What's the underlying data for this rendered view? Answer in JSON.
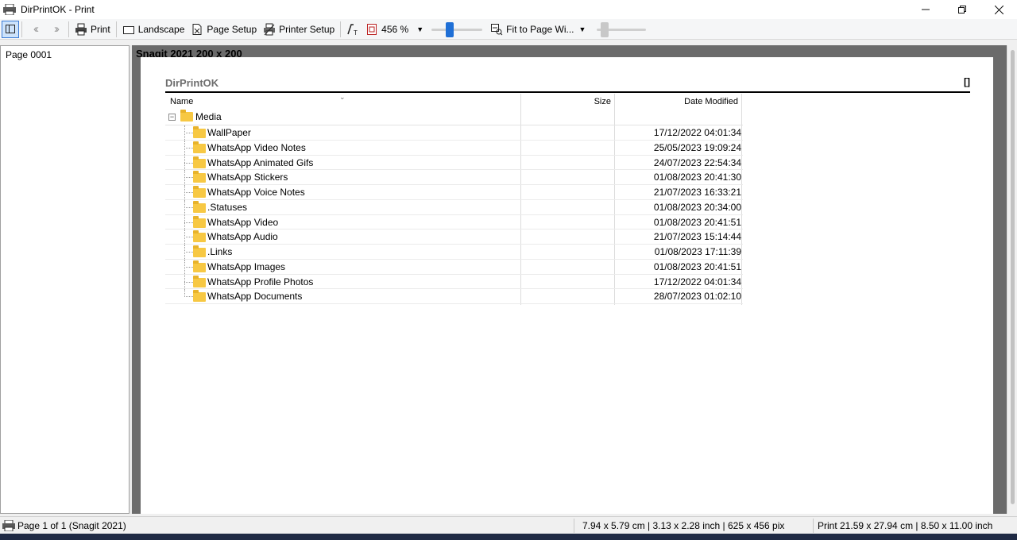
{
  "window": {
    "title": "DirPrintOK - Print",
    "minimize_icon": "minimize-icon",
    "maximize_icon": "restore-icon",
    "close_icon": "close-icon"
  },
  "toolbar": {
    "print_label": "Print",
    "landscape_label": "Landscape",
    "page_setup_label": "Page Setup",
    "printer_setup_label": "Printer Setup",
    "zoom_value": "456 %",
    "fit_label": "Fit to Page Wi...",
    "zoom_slider_level": 0.33,
    "second_slider_level": 0.1,
    "accent_color": "#1f6fd6"
  },
  "sidebar": {
    "pages": [
      "Page 0001"
    ]
  },
  "preview": {
    "caption": "Snagit 2021 200 x 200",
    "report_title": "DirPrintOK",
    "report_mark": "[]",
    "columns": {
      "name": "Name",
      "size": "Size",
      "date": "Date Modified"
    },
    "root_folder": "Media",
    "rows": [
      {
        "name": "WallPaper",
        "date": "17/12/2022 04:01:34"
      },
      {
        "name": "WhatsApp Video Notes",
        "date": "25/05/2023 19:09:24"
      },
      {
        "name": "WhatsApp Animated Gifs",
        "date": "24/07/2023 22:54:34"
      },
      {
        "name": "WhatsApp Stickers",
        "date": "01/08/2023 20:41:30"
      },
      {
        "name": "WhatsApp Voice Notes",
        "date": "21/07/2023 16:33:21"
      },
      {
        "name": ".Statuses",
        "date": "01/08/2023 20:34:00"
      },
      {
        "name": "WhatsApp Video",
        "date": "01/08/2023 20:41:51"
      },
      {
        "name": "WhatsApp Audio",
        "date": "21/07/2023 15:14:44"
      },
      {
        "name": ".Links",
        "date": "01/08/2023 17:11:39"
      },
      {
        "name": "WhatsApp Images",
        "date": "01/08/2023 20:41:51"
      },
      {
        "name": "WhatsApp Profile Photos",
        "date": "17/12/2022 04:01:34"
      },
      {
        "name": "WhatsApp Documents",
        "date": "28/07/2023 01:02:10"
      }
    ]
  },
  "statusbar": {
    "page_info": "Page 1 of 1 (Snagit 2021)",
    "dimensions": "7.94 x 5.79 cm | 3.13 x 2.28 inch | 625 x 456 pix",
    "print_size": "Print 21.59 x 27.94 cm |  8.50 x 11.00 inch"
  }
}
